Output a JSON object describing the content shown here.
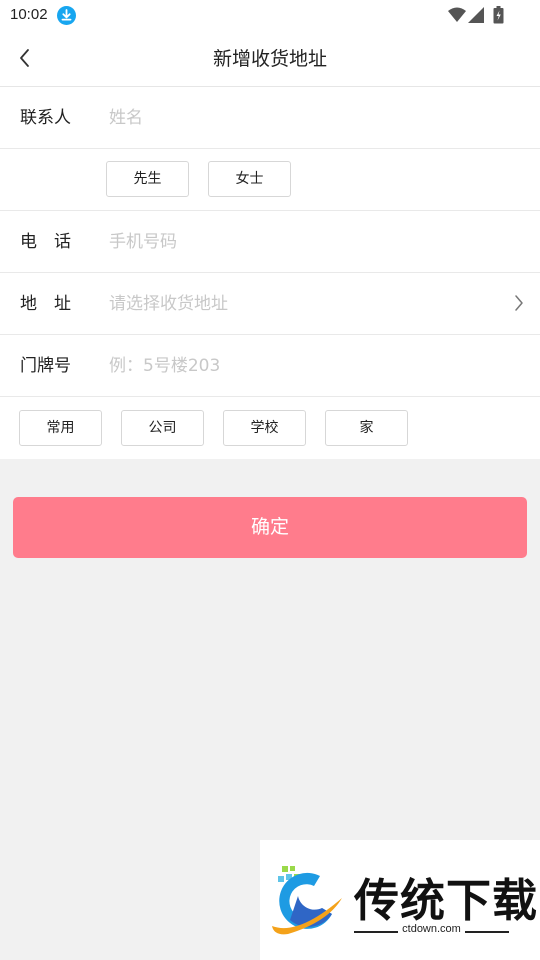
{
  "status_bar": {
    "time": "10:02",
    "icons": [
      "download-icon",
      "wifi-icon",
      "signal-icon",
      "battery-icon"
    ]
  },
  "header": {
    "back_icon": "chevron-left-icon",
    "title": "新增收货地址"
  },
  "form": {
    "contact": {
      "label": "联系人",
      "placeholder": "姓名"
    },
    "gender_options": [
      "先生",
      "女士"
    ],
    "phone": {
      "label": "电　话",
      "placeholder": "手机号码"
    },
    "address": {
      "label": "地　址",
      "placeholder": "请选择收货地址",
      "icon": "chevron-right-icon"
    },
    "door": {
      "label": "门牌号",
      "placeholder": "例：5号楼203"
    },
    "tag_options": [
      "常用",
      "公司",
      "学校",
      "家"
    ]
  },
  "confirm": {
    "label": "确定"
  },
  "watermark": {
    "title": "传统下载",
    "url": "ctdown.com"
  },
  "colors": {
    "accent": "#ff7c8c",
    "download_badge": "#17a6f0",
    "background": "#f1f1f1"
  }
}
